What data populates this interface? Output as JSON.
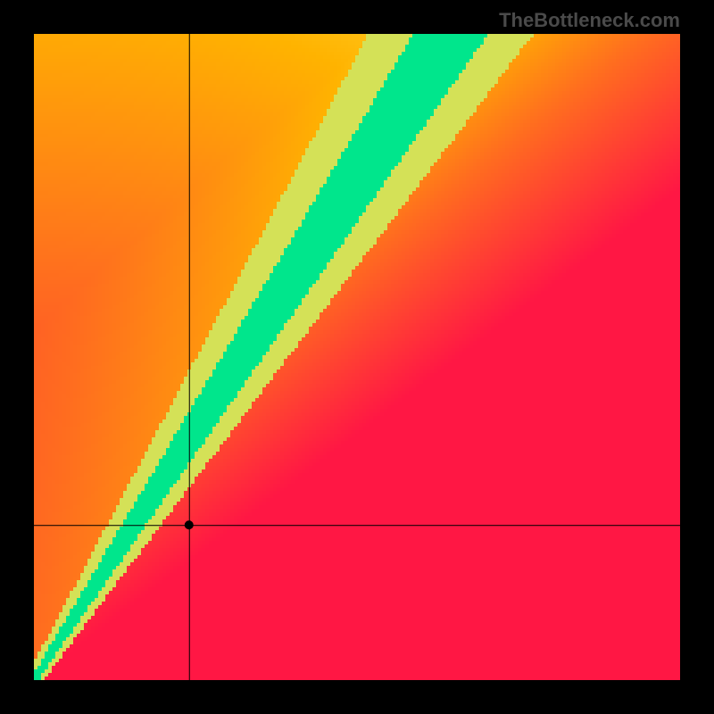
{
  "watermark": "TheBottleneck.com",
  "chart_data": {
    "type": "heatmap",
    "title": "",
    "xlabel": "",
    "ylabel": "",
    "xlim": [
      0,
      100
    ],
    "ylim": [
      0,
      100
    ],
    "grid": false,
    "legend": false,
    "marker": {
      "x": 24,
      "y": 24
    },
    "crosshair": {
      "x": 24,
      "y": 24
    },
    "ridge": {
      "description": "Optimal-balance ridge from bottom-left toward upper-right; green band narrows at origin and widens toward top-right. Field grades from red (far from ridge) through orange/yellow to green on the ridge.",
      "slope_approx": 1.55,
      "band_halfwidth_frac_at_origin": 0.01,
      "band_halfwidth_frac_at_max": 0.09
    },
    "color_stops": [
      {
        "pos": 0.0,
        "hex": "#ff1744"
      },
      {
        "pos": 0.35,
        "hex": "#ff6d1f"
      },
      {
        "pos": 0.6,
        "hex": "#ffb300"
      },
      {
        "pos": 0.8,
        "hex": "#ffee58"
      },
      {
        "pos": 0.92,
        "hex": "#d4e157"
      },
      {
        "pos": 1.0,
        "hex": "#00e68c"
      }
    ],
    "grid_resolution": 181
  }
}
